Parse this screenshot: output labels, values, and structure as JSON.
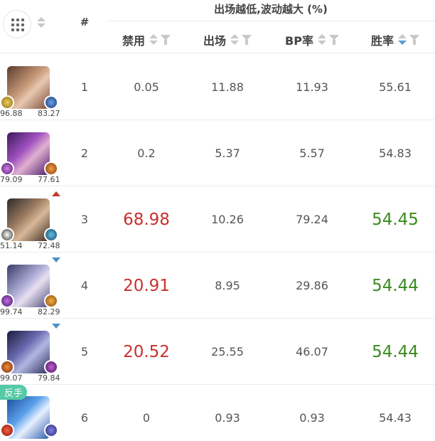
{
  "header": {
    "rank_symbol": "#",
    "group_title": "出场越低,波动越大 (%)",
    "columns": [
      {
        "key": "ban",
        "label": "禁用"
      },
      {
        "key": "pick",
        "label": "出场"
      },
      {
        "key": "bp",
        "label": "BP率"
      },
      {
        "key": "win",
        "label": "胜率",
        "sorted": "descending"
      }
    ]
  },
  "colors": {
    "red_highlight": "#c8302e",
    "green_highlight": "#3b8a1e",
    "sort_active": "#5b9bd5",
    "tag_bg": "#56c9a6"
  },
  "rows": [
    {
      "rank": "1",
      "ban": "0.05",
      "pick": "11.88",
      "bp": "11.93",
      "win": "55.61",
      "stat_left": "96.88",
      "stat_right": "83.27",
      "trend": "",
      "tag": ""
    },
    {
      "rank": "2",
      "ban": "0.2",
      "pick": "5.37",
      "bp": "5.57",
      "win": "54.83",
      "stat_left": "79.09",
      "stat_right": "77.61",
      "trend": "",
      "tag": ""
    },
    {
      "rank": "3",
      "ban": "68.98",
      "pick": "10.26",
      "bp": "79.24",
      "win": "54.45",
      "stat_left": "51.14",
      "stat_right": "72.48",
      "trend": "up",
      "tag": ""
    },
    {
      "rank": "4",
      "ban": "20.91",
      "pick": "8.95",
      "bp": "29.86",
      "win": "54.44",
      "stat_left": "99.74",
      "stat_right": "82.29",
      "trend": "down",
      "tag": ""
    },
    {
      "rank": "5",
      "ban": "20.52",
      "pick": "25.55",
      "bp": "46.07",
      "win": "54.44",
      "stat_left": "99.07",
      "stat_right": "79.84",
      "trend": "down",
      "tag": ""
    },
    {
      "rank": "6",
      "ban": "0",
      "pick": "0.93",
      "bp": "0.93",
      "win": "54.43",
      "stat_left": "",
      "stat_right": "",
      "trend": "",
      "tag": "反手"
    }
  ]
}
